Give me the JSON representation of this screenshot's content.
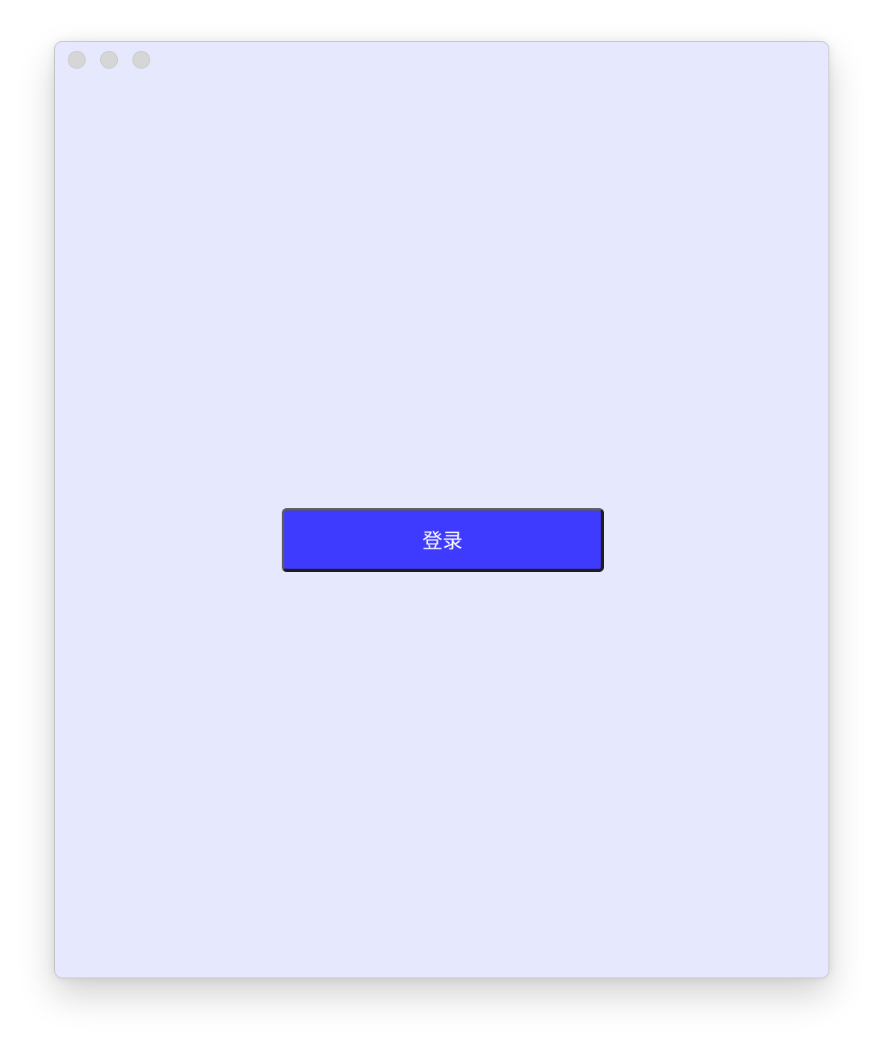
{
  "window": {
    "background": "#e6e8fd",
    "controls": [
      "close",
      "minimize",
      "maximize"
    ]
  },
  "login_button": {
    "label": "登录",
    "color": "#3e3bff"
  }
}
